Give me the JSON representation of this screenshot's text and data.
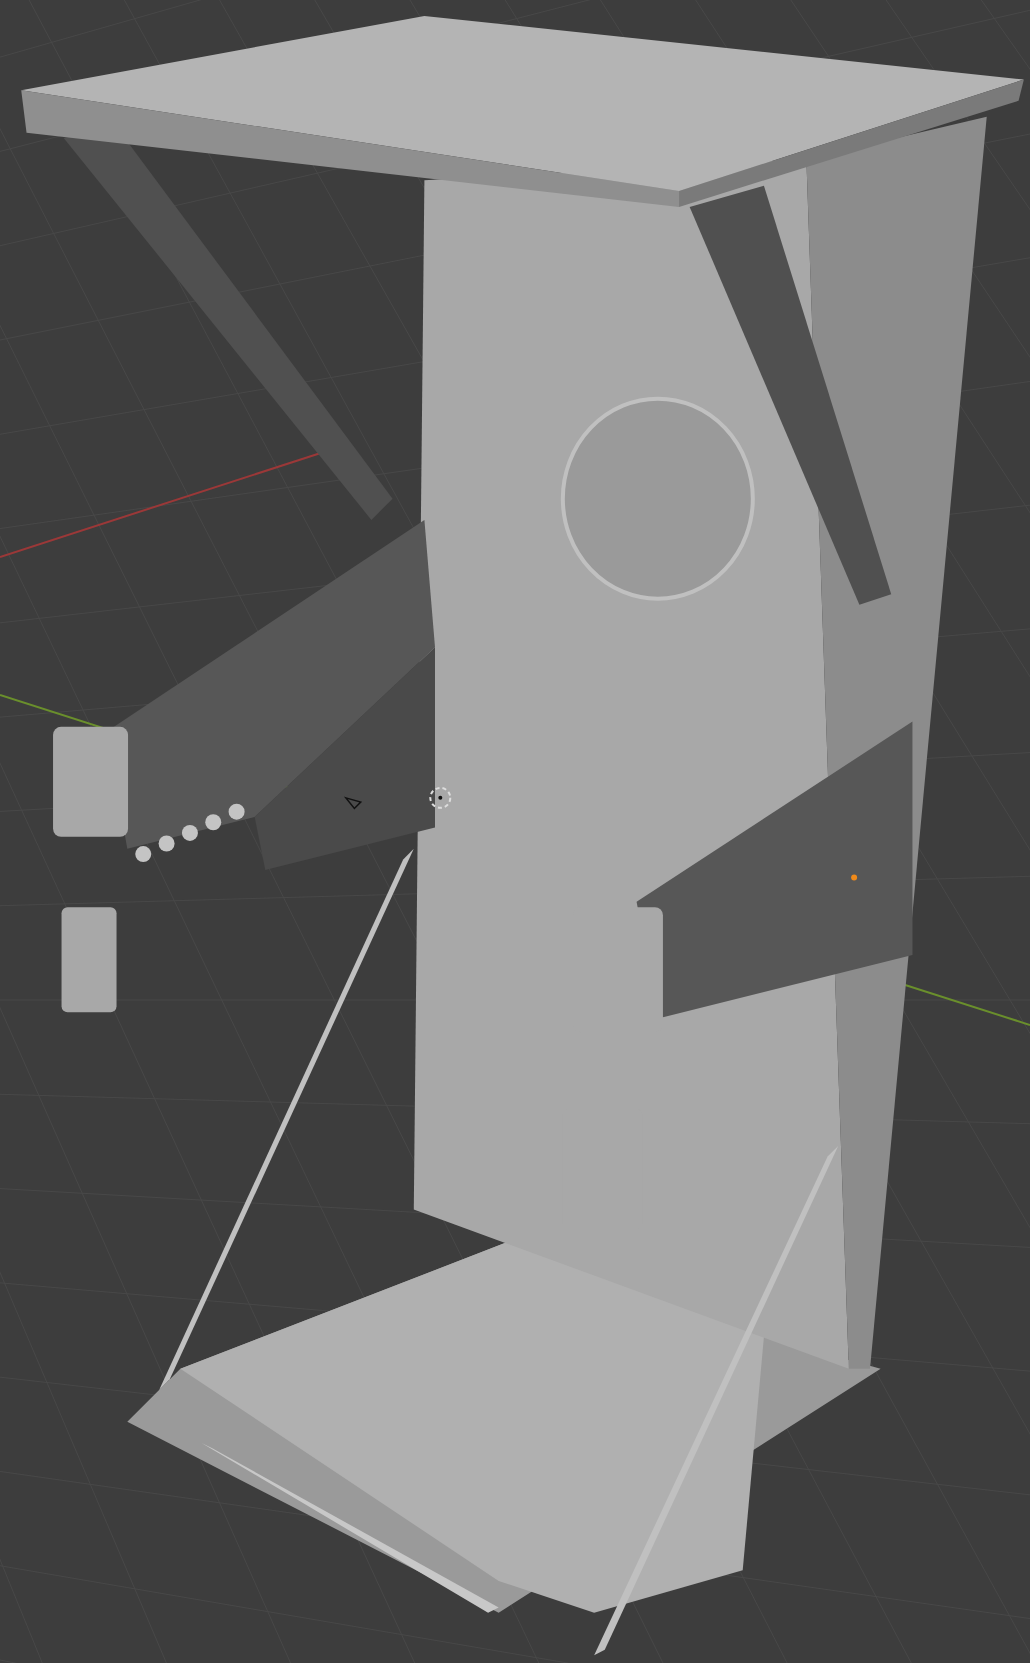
{
  "viewport": {
    "grid_visible": true,
    "cursor_visible": true
  }
}
